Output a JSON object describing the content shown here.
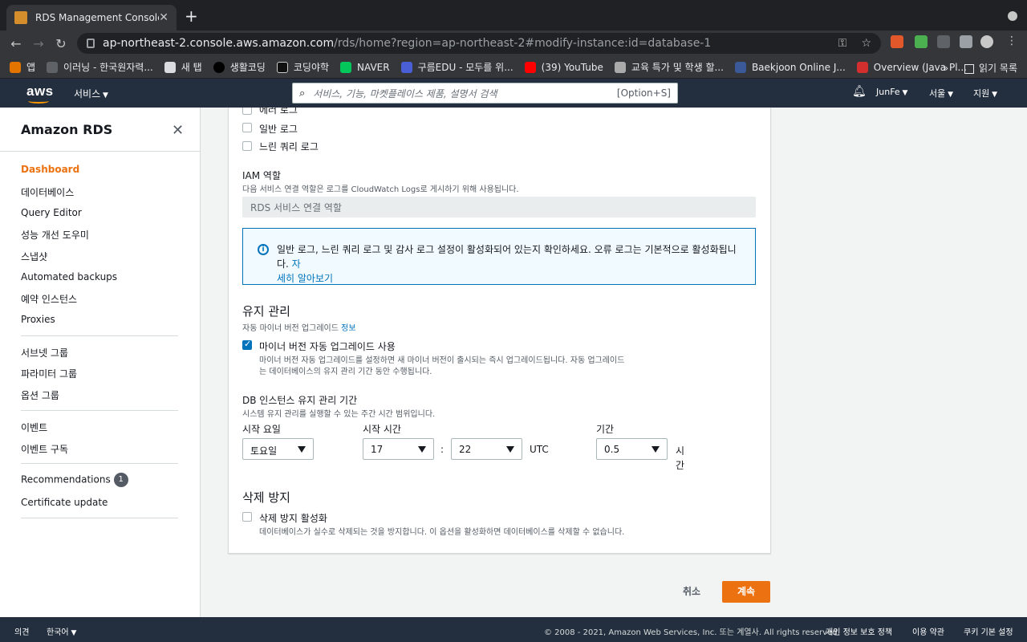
{
  "browser": {
    "tab_title": "RDS Management Console",
    "url_host": "ap-northeast-2.console.aws.amazon.com",
    "url_path": "/rds/home?region=ap-northeast-2#modify-instance:id=database-1",
    "bookmarks": [
      "앱",
      "이러닝 - 한국원자력...",
      "새 탭",
      "생활코딩",
      "코딩야학",
      "NAVER",
      "구름EDU - 모두를 위...",
      "(39) YouTube",
      "교육 특가 및 학생 할...",
      "Baekjoon Online J...",
      "Overview (Java Pl..."
    ],
    "bookmarks_more": "»",
    "reading_list": "읽기 목록"
  },
  "header": {
    "logo": "aws",
    "services": "서비스",
    "search_placeholder": "서비스, 기능, 마켓플레이스 제품, 설명서 검색",
    "search_shortcut": "[Option+S]",
    "user": "JunFe",
    "region": "서울",
    "support": "지원"
  },
  "sidebar": {
    "title": "Amazon RDS",
    "group1": [
      "Dashboard",
      "데이터베이스",
      "Query Editor",
      "성능 개선 도우미",
      "스냅샷",
      "Automated backups",
      "예약 인스턴스",
      "Proxies"
    ],
    "group2": [
      "서브넷 그룹",
      "파라미터 그룹",
      "옵션 그룹"
    ],
    "group3": [
      "이벤트",
      "이벤트 구독"
    ],
    "recommendations": "Recommendations",
    "recommendations_count": "1",
    "certificate": "Certificate update"
  },
  "logs": {
    "error_log": "에러 로그",
    "general_log": "일반 로그",
    "slow_query_log": "느린 쿼리 로그"
  },
  "iam": {
    "title": "IAM 역할",
    "desc": "다음 서비스 연결 역할은 로그를 CloudWatch Logs로 게시하기 위해 사용됩니다.",
    "value": "RDS 서비스 연결 역할"
  },
  "info": {
    "text": "일반 로그, 느린 쿼리 로그 및 감사 로그 설정이 활성화되어 있는지 확인하세요. 오류 로그는 기본적으로 활성화됩니다.",
    "link1": " 자",
    "link2": "세히 알아보기"
  },
  "maintenance": {
    "title": "유지 관리",
    "subtitle": "자동 마이너 버전 업그레이드",
    "info_link": "정보",
    "auto_upgrade_label": "마이너 버전 자동 업그레이드 사용",
    "auto_upgrade_desc1": "마이너 버전 자동 업그레이드를 설정하면 새 마이너 버전이 출시되는 즉시 업그레이드됩니다. 자동 업그레이드",
    "auto_upgrade_desc2": "는 데이터베이스의 유지 관리 기간 동안 수행됩니다.",
    "auto_upgrade_checked": true,
    "window_title": "DB 인스턴스 유지 관리 기간",
    "window_desc": "시스템 유지 관리를 실행할 수 있는 주간 시간 범위입니다.",
    "start_day_label": "시작 요일",
    "start_day": "토요일",
    "start_time_label": "시작 시간",
    "start_hour": "17",
    "start_minute": "22",
    "colon": ":",
    "tz": "UTC",
    "duration_label": "기간",
    "duration": "0.5",
    "hours_unit1": "시",
    "hours_unit2": "간"
  },
  "deletion": {
    "title": "삭제 방지",
    "label": "삭제 방지 활성화",
    "desc": "데이터베이스가 실수로 삭제되는 것을 방지합니다. 이 옵션을 활성화하면 데이터베이스를 삭제할 수 없습니다.",
    "checked": false
  },
  "actions": {
    "cancel": "취소",
    "continue": "계속"
  },
  "footer": {
    "feedback": "의견",
    "language": "한국어",
    "copyright": "© 2008 - 2021, Amazon Web Services, Inc. 또는 계열사. All rights reserved.",
    "privacy": "개인 정보 보호 정책",
    "terms": "이용 약관",
    "cookies": "쿠키 기본 설정"
  }
}
